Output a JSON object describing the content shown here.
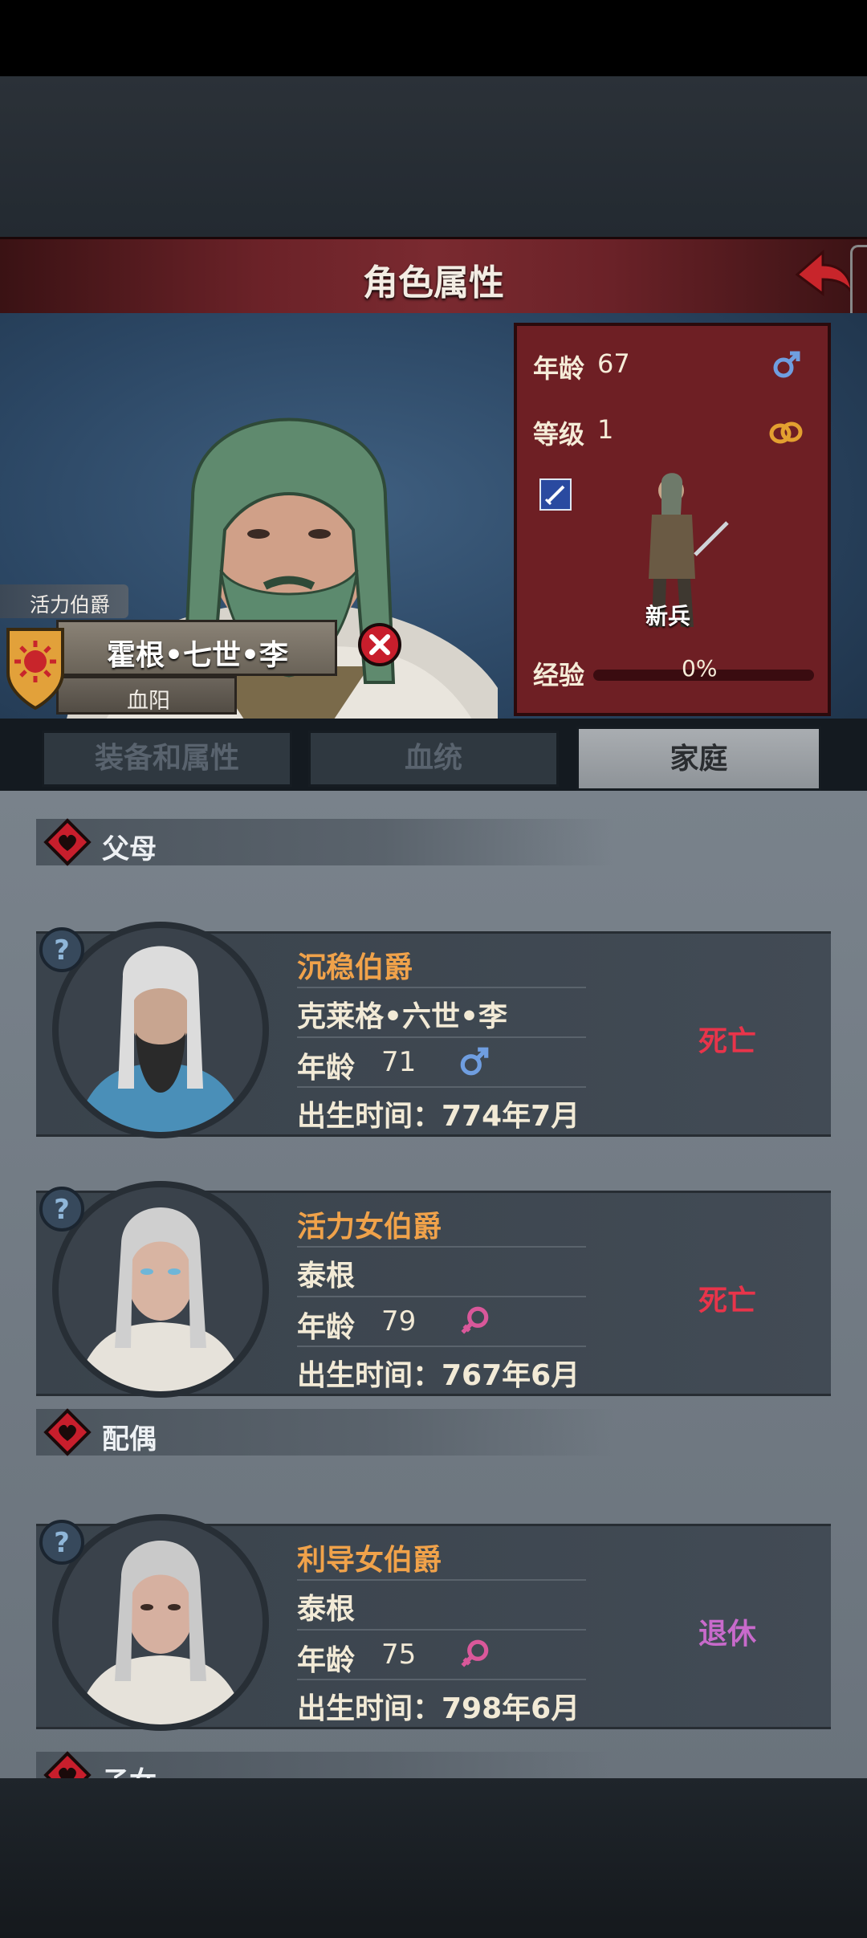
{
  "header": {
    "title": "角色属性"
  },
  "character": {
    "title": "活力伯爵",
    "name": "霍根•七世•李",
    "house": "血阳",
    "stats": {
      "age_label": "年龄",
      "age": "67",
      "level_label": "等级",
      "level": "1",
      "unit_name": "新兵",
      "exp_label": "经验",
      "exp_text": "0%",
      "exp_fraction": 0
    }
  },
  "tabs": [
    {
      "label": "装备和属性",
      "active": false
    },
    {
      "label": "血统",
      "active": false
    },
    {
      "label": "家庭",
      "active": true
    }
  ],
  "sections": {
    "parents": "父母",
    "spouse": "配偶",
    "children": "子女"
  },
  "members": [
    {
      "title": "沉稳伯爵",
      "name": "克莱格•六世•李",
      "age_label": "年龄",
      "age": "71",
      "gender": "male",
      "birth": "出生时间：774年7月",
      "status": "死亡",
      "status_color": "#e8344a"
    },
    {
      "title": "活力女伯爵",
      "name": "泰根",
      "age_label": "年龄",
      "age": "79",
      "gender": "female",
      "birth": "出生时间：767年6月",
      "status": "死亡",
      "status_color": "#e8344a"
    },
    {
      "title": "利导女伯爵",
      "name": "泰根",
      "age_label": "年龄",
      "age": "75",
      "gender": "female",
      "birth": "出生时间：798年6月",
      "status": "退休",
      "status_color": "#c86acb"
    }
  ],
  "colors": {
    "banner": "#6b2228",
    "accent_title": "#f0a24a",
    "male": "#6f9ee0",
    "female": "#d9589a"
  }
}
